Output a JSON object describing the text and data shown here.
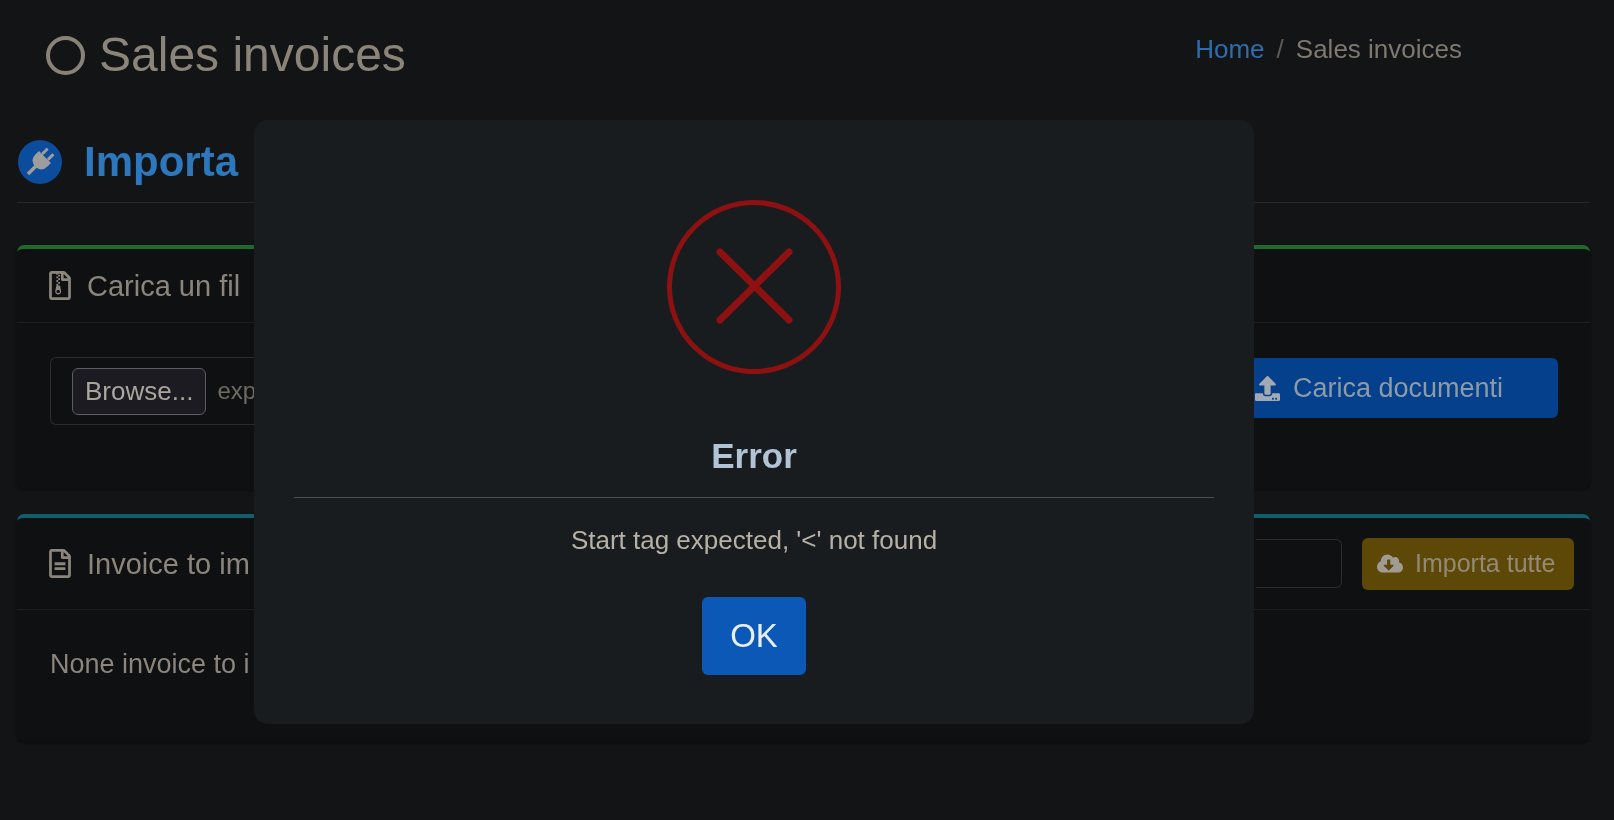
{
  "page_header": {
    "title": "Sales invoices",
    "breadcrumb": {
      "separator": "/",
      "items": [
        {
          "label": "Home",
          "kind": "link"
        },
        {
          "label": "Sales invoices",
          "kind": "current"
        }
      ]
    }
  },
  "section": {
    "title": "Importa"
  },
  "upload_card": {
    "title": "Carica un fil",
    "file_input": {
      "button": "Browse...",
      "value": "exp"
    },
    "submit_button": "Carica documenti"
  },
  "invoices_card": {
    "title": "Invoice to im",
    "import_button": "Importa tutte",
    "empty_message": "None invoice to i"
  },
  "dialog": {
    "title": "Error",
    "message": "Start tag expected, '<' not found",
    "buttons": [
      "OK"
    ]
  }
}
